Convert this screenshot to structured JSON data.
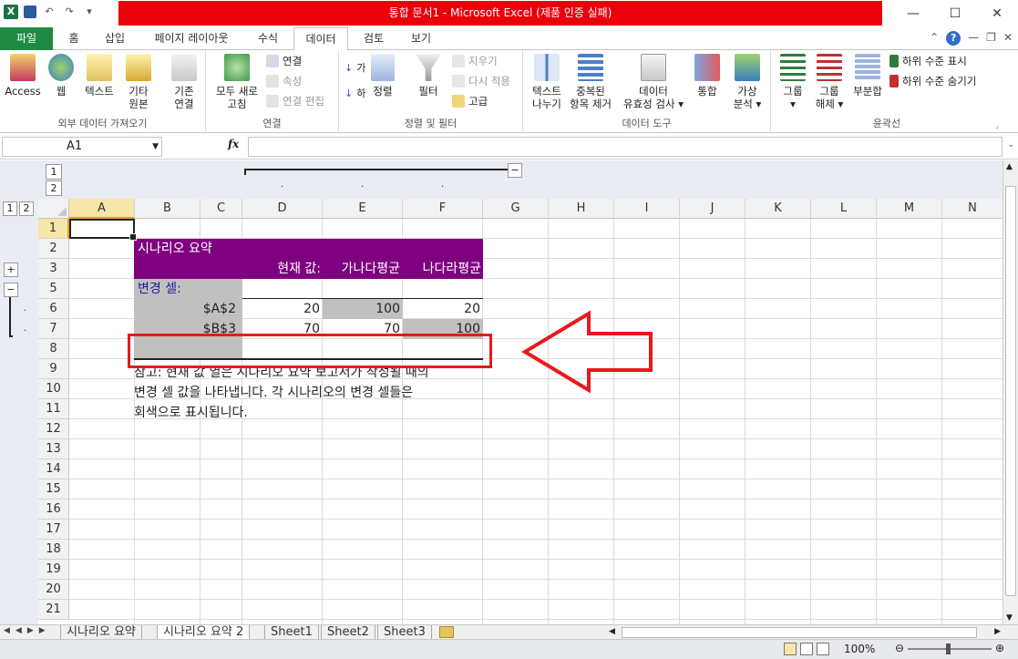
{
  "window": {
    "title": "통합 문서1  -  Microsoft Excel (제품 인증 실패)",
    "logo": "X"
  },
  "ribbon_tabs": [
    "파일",
    "홈",
    "삽입",
    "페이지 레이아웃",
    "수식",
    "데이터",
    "검토",
    "보기"
  ],
  "active_tab": "데이터",
  "ribbon": {
    "external_data": {
      "label": "외부 데이터 가져오기",
      "access": "Access",
      "web": "웹",
      "text": "텍스트",
      "other_l1": "기타",
      "other_l2": "원본",
      "existing_l1": "기존",
      "existing_l2": "연결"
    },
    "connections": {
      "label": "연결",
      "refresh_l1": "모두 새로",
      "refresh_l2": "고침",
      "connect": "연결",
      "properties": "속성",
      "edit_links": "연결 편집"
    },
    "sort_filter": {
      "label": "정렬 및 필터",
      "sort_az": "가",
      "sort_za": "하",
      "sort": "정렬",
      "filter": "필터",
      "clear": "지우기",
      "reapply": "다시 적용",
      "advanced": "고급"
    },
    "data_tools": {
      "label": "데이터 도구",
      "text_to_col_l1": "텍스트",
      "text_to_col_l2": "나누기",
      "remove_dup_l1": "중복된",
      "remove_dup_l2": "항목 제거",
      "validation_l1": "데이터",
      "validation_l2": "유효성 검사",
      "consolidate": "통합",
      "whatif_l1": "가상",
      "whatif_l2": "분석"
    },
    "outline": {
      "label": "윤곽선",
      "group": "그룹",
      "ungroup_l1": "그룹",
      "ungroup_l2": "해제",
      "subtotal": "부분합",
      "show_detail": "하위 수준 표시",
      "hide_detail": "하위 수준 숨기기"
    }
  },
  "formula_bar": {
    "name_box": "A1",
    "fx": "fx",
    "formula": ""
  },
  "outline_levels": [
    "1",
    "2"
  ],
  "columns": [
    "A",
    "B",
    "C",
    "D",
    "E",
    "F",
    "G",
    "H",
    "I",
    "J",
    "K",
    "L",
    "M",
    "N"
  ],
  "rows": [
    "1",
    "2",
    "3",
    "5",
    "6",
    "7",
    "8",
    "9",
    "10",
    "11",
    "12",
    "13",
    "14",
    "15",
    "16",
    "17",
    "18",
    "19",
    "20",
    "21"
  ],
  "outline_buttons": {
    "plus": "+",
    "minus": "−",
    "minus_top": "−"
  },
  "scenario": {
    "title": "시나리오 요약",
    "col_current": "현재 값:",
    "col_s1": "가나다평균",
    "col_s2": "나다라평균",
    "changing_cells": "변경 셀:",
    "cell_a2": "$A$2",
    "cell_b3": "$B$3",
    "a2_values": [
      "20",
      "100",
      "20"
    ],
    "b3_values": [
      "70",
      "70",
      "100"
    ],
    "note_l1": "참고: 현재 값 열은 시나리오 요약 보고서가 작성될 때의",
    "note_l2": "변경 셀 값을 나타냅니다. 각 시나리오의 변경 셀들은",
    "note_l3": "회색으로 표시됩니다."
  },
  "sheet_tabs": [
    "시나리오 요약",
    "시나리오 요약 2",
    "Sheet1",
    "Sheet2",
    "Sheet3"
  ],
  "active_sheet": "시나리오 요약 2",
  "status": {
    "zoom": "100%",
    "zoom_level": 1.0
  },
  "colors": {
    "accent_title": "#e8000b",
    "file_tab": "#1f8a44",
    "scenario_header": "#7f017f",
    "changing_cells_text": "#1f1f9f",
    "highlight_gray": "#c0c0c0",
    "annotation_red": "#e8191c"
  }
}
